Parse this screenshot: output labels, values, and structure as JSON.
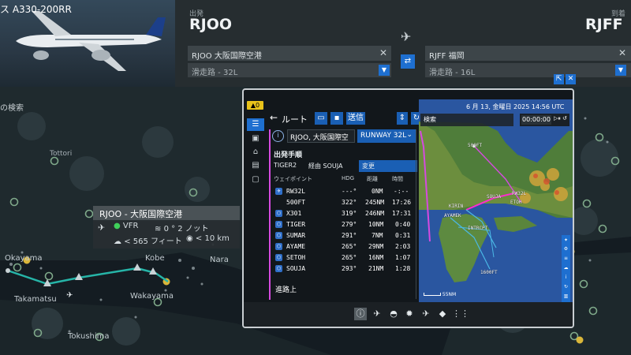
{
  "aircraft": {
    "name": "ス A330-200RR"
  },
  "departure": {
    "label": "出発",
    "code": "RJOO",
    "airport_field": "RJOO 大阪国際空港",
    "runway_field": "滑走路 - 32L"
  },
  "arrival": {
    "label": "到着",
    "code": "RJFF",
    "airport_field": "RJFF 福岡",
    "runway_field": "滑走路 - 16L"
  },
  "map": {
    "search_label": "の検索",
    "tottori": "Tottori",
    "cities": [
      "Okayama",
      "Kobe",
      "Nara",
      "Takamatsu",
      "Wakayama",
      "Tokushima"
    ]
  },
  "airport_card": {
    "title": "RJOO - 大阪国際空港",
    "flight_rules": "VFR",
    "wind": "0 ° 2 ノット",
    "ceiling": "< 565 フィート",
    "visibility": "< 10 km"
  },
  "panel": {
    "badge": "0",
    "route_title": "ルート",
    "send_label": "送信",
    "from_field": "RJOO, 大阪国際空",
    "runway_button": "RUNWAY 32L",
    "departure_procedure_title": "出発手順",
    "procedure": {
      "name": "TIGER2",
      "via": "経由 SOUJA",
      "change": "変更"
    },
    "waypoint_headers": {
      "waypoint": "ウェイポイント",
      "hdg": "HDG",
      "distance": "距離",
      "time": "時間"
    },
    "waypoints": [
      {
        "name": "RW32L",
        "hdg": "---°",
        "dist": "0NM",
        "time": "-:--"
      },
      {
        "name": "500FT",
        "hdg": "322°",
        "dist": "245NM",
        "time": "17:26"
      },
      {
        "name": "X301",
        "hdg": "319°",
        "dist": "246NM",
        "time": "17:31"
      },
      {
        "name": "TIGER",
        "hdg": "279°",
        "dist": "10NM",
        "time": "0:40"
      },
      {
        "name": "SUMAR",
        "hdg": "291°",
        "dist": "7NM",
        "time": "0:31"
      },
      {
        "name": "AYAME",
        "hdg": "265°",
        "dist": "29NM",
        "time": "2:03"
      },
      {
        "name": "SETOH",
        "hdg": "265°",
        "dist": "16NM",
        "time": "1:07"
      },
      {
        "name": "SOUJA",
        "hdg": "293°",
        "dist": "21NM",
        "time": "1:28"
      }
    ],
    "enroute_title": "進路上"
  },
  "minimap": {
    "datetime": "6 月 13, 金曜日 2025 14:56 UTC",
    "search_placeholder": "検索",
    "time_value": "00:00:00",
    "scale": "55NM",
    "labels": [
      "500FT",
      "RW32L",
      "SOUJA",
      "ETOH",
      "INTRCPT",
      "AYAMEK",
      "1600FT",
      "KIRIN"
    ]
  }
}
